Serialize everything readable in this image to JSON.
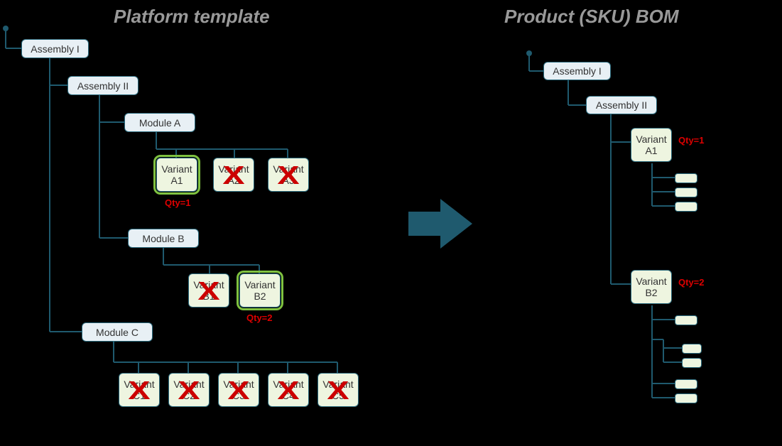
{
  "titles": {
    "left": "Platform template",
    "right": "Product (SKU) BOM"
  },
  "left_tree": {
    "assembly1": "Assembly I",
    "assembly2": "Assembly II",
    "moduleA": "Module A",
    "moduleB": "Module B",
    "moduleC": "Module C",
    "variantA1": "Variant A1",
    "variantA2": "Variant A2",
    "variantA3": "Variant A3",
    "variantB1": "Variant B1",
    "variantB2": "Variant B2",
    "variantC1": "Variant C1",
    "variantC2": "Variant C2",
    "variantC3": "Variant C3",
    "variantC4": "Variant C4",
    "variantC5": "Variant C5",
    "qtyA1": "Qty=1",
    "qtyB2": "Qty=2"
  },
  "right_tree": {
    "assembly1": "Assembly I",
    "assembly2": "Assembly II",
    "variantA1": "Variant A1",
    "variantB2": "Variant B2",
    "qtyA1": "Qty=1",
    "qtyB2": "Qty=2"
  },
  "selections": {
    "moduleA_chosen": "A1",
    "moduleB_chosen": "B2",
    "moduleC_chosen": null
  }
}
